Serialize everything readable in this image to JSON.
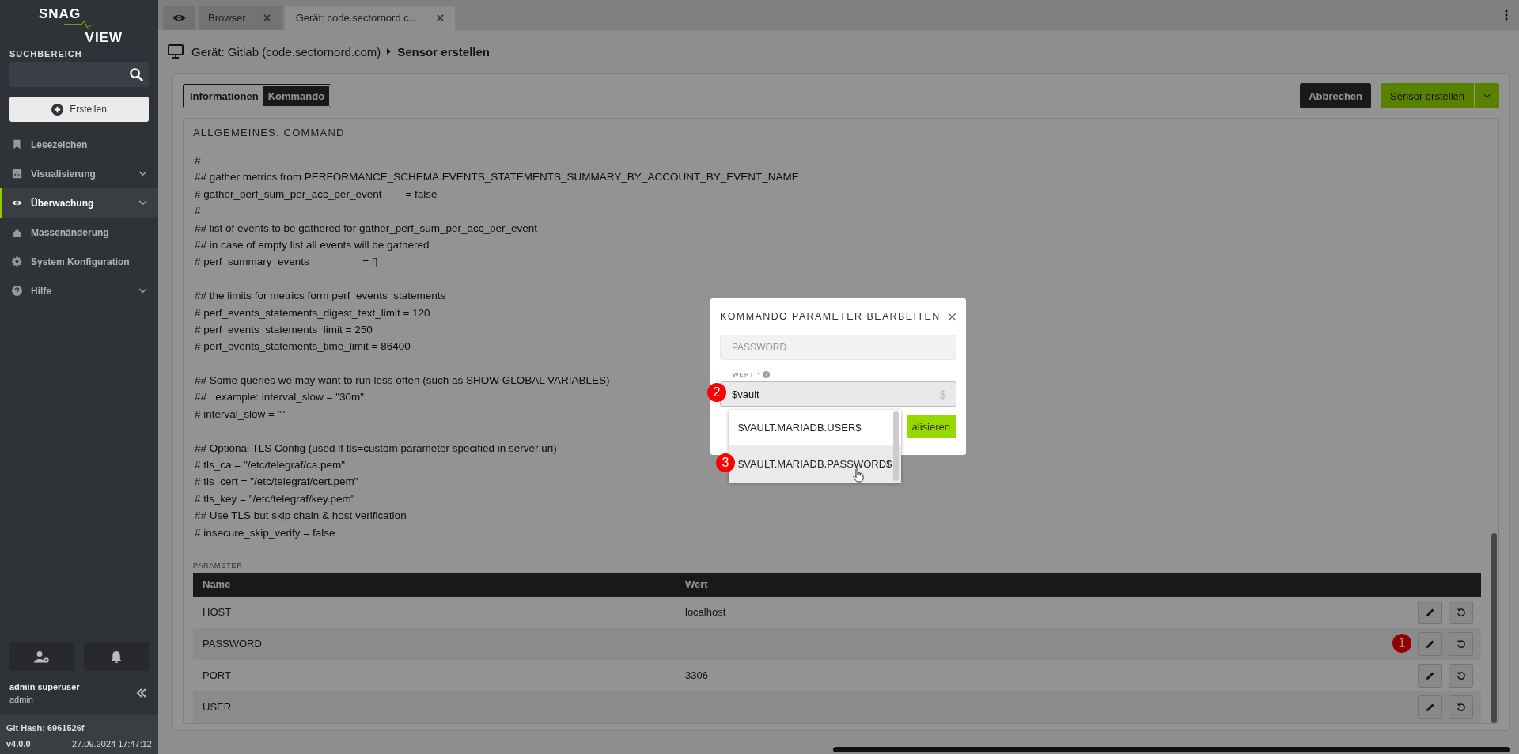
{
  "sidebar": {
    "logo_top": "SNAG",
    "logo_bottom": "VIEW",
    "search_label": "SUCHBEREICH",
    "create_button": "Erstellen",
    "items": [
      {
        "label": "Lesezeichen",
        "selected": false,
        "expandable": false
      },
      {
        "label": "Visualisierung",
        "selected": false,
        "expandable": true
      },
      {
        "label": "Überwachung",
        "selected": true,
        "expandable": true
      },
      {
        "label": "Massenänderung",
        "selected": false,
        "expandable": false
      },
      {
        "label": "System Konfiguration",
        "selected": false,
        "expandable": false
      },
      {
        "label": "Hilfe",
        "selected": false,
        "expandable": true
      }
    ],
    "user_name": "admin superuser",
    "user_login": "admin",
    "git_hash": "Git Hash: 6961526f",
    "version": "v4.0.0",
    "build_time": "27.09.2024 17:47:12"
  },
  "tabs": [
    {
      "label": "Browser",
      "selected": false
    },
    {
      "label": "Gerät: code.sectornord.c...",
      "selected": true
    }
  ],
  "breadcrumb": {
    "parent": "Gerät: Gitlab (code.sectornord.com)",
    "current": "Sensor erstellen"
  },
  "view_tabs": [
    {
      "label": "Informationen",
      "selected": false
    },
    {
      "label": "Kommando",
      "selected": true
    }
  ],
  "actions": {
    "cancel": "Abbrechen",
    "create": "Sensor erstellen"
  },
  "command": {
    "title": "ALLGEMEINES: COMMAND",
    "blocks": [
      [
        "#",
        "## gather metrics from PERFORMANCE_SCHEMA.EVENTS_STATEMENTS_SUMMARY_BY_ACCOUNT_BY_EVENT_NAME",
        "# gather_perf_sum_per_acc_per_event        = false",
        "#",
        "## list of events to be gathered for gather_perf_sum_per_acc_per_event",
        "## in case of empty list all events will be gathered",
        "# perf_summary_events                  = []"
      ],
      [
        "## the limits for metrics form perf_events_statements",
        "# perf_events_statements_digest_text_limit = 120",
        "# perf_events_statements_limit = 250",
        "# perf_events_statements_time_limit = 86400"
      ],
      [
        "## Some queries we may want to run less often (such as SHOW GLOBAL VARIABLES)",
        "##   example: interval_slow = \"30m\"",
        "# interval_slow = \"\""
      ],
      [
        "## Optional TLS Config (used if tls=custom parameter specified in server uri)",
        "# tls_ca = \"/etc/telegraf/ca.pem\"",
        "# tls_cert = \"/etc/telegraf/cert.pem\"",
        "# tls_key = \"/etc/telegraf/key.pem\"",
        "## Use TLS but skip chain & host verification",
        "# insecure_skip_verify = false"
      ]
    ]
  },
  "parameters": {
    "title": "PARAMETER",
    "columns": [
      "Name",
      "Wert"
    ],
    "rows": [
      {
        "name": "HOST",
        "value": "localhost"
      },
      {
        "name": "PASSWORD",
        "callout": "1"
      },
      {
        "name": "PORT",
        "value": "3306"
      },
      {
        "name": "USER"
      }
    ]
  },
  "dialog": {
    "title": "KOMMANDO PARAMETER BEARBEITEN",
    "name_value": "PASSWORD",
    "value_label": "WERT",
    "required_mark": "*",
    "value": "$vault",
    "value_callout": "2",
    "suffix": "$",
    "button": "alisieren",
    "suggestions": [
      {
        "label": "$VAULT.MARIADB.USER$",
        "selected": false
      },
      {
        "label": "$VAULT.MARIADB.PASSWORD$",
        "selected": true,
        "callout": "3"
      }
    ]
  }
}
